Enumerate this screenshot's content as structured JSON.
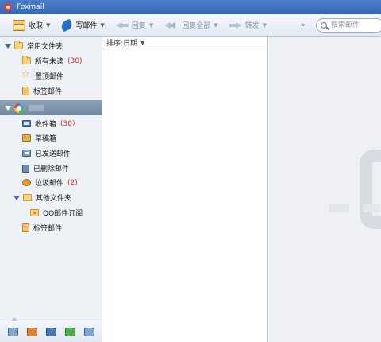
{
  "window": {
    "title": "Foxmail"
  },
  "toolbar": {
    "receive": "收取",
    "write": "写邮件",
    "reply": "回复",
    "reply_all": "回复全部",
    "forward": "转发",
    "more": "»"
  },
  "search": {
    "placeholder": "搜索邮件"
  },
  "sidebar": {
    "common_group": {
      "label": "常用文件夹",
      "items": [
        {
          "label": "所有未读",
          "count": "(30)",
          "icon": "folder-icon"
        },
        {
          "label": "置顶邮件",
          "icon": "star-icon"
        },
        {
          "label": "标签邮件",
          "icon": "tag-icon"
        }
      ]
    },
    "account": {
      "items": [
        {
          "label": "收件箱",
          "count": "(30)",
          "icon": "inbox-icon"
        },
        {
          "label": "草稿箱",
          "icon": "draft-icon"
        },
        {
          "label": "已发送邮件",
          "icon": "sent-icon"
        },
        {
          "label": "已删除邮件",
          "icon": "trash-icon"
        },
        {
          "label": "垃圾邮件",
          "count": "(2)",
          "icon": "spam-icon"
        },
        {
          "label": "其他文件夹",
          "icon": "folder-icon"
        },
        {
          "label": "QQ邮件订阅",
          "icon": "rss-folder-icon"
        },
        {
          "label": "标签邮件",
          "icon": "tag-icon"
        }
      ]
    },
    "bottom_icons": [
      "mail-icon",
      "contacts-icon",
      "calendar-icon",
      "notes-icon",
      "picture-icon"
    ]
  },
  "maillist": {
    "sort_label": "排序:日期"
  }
}
